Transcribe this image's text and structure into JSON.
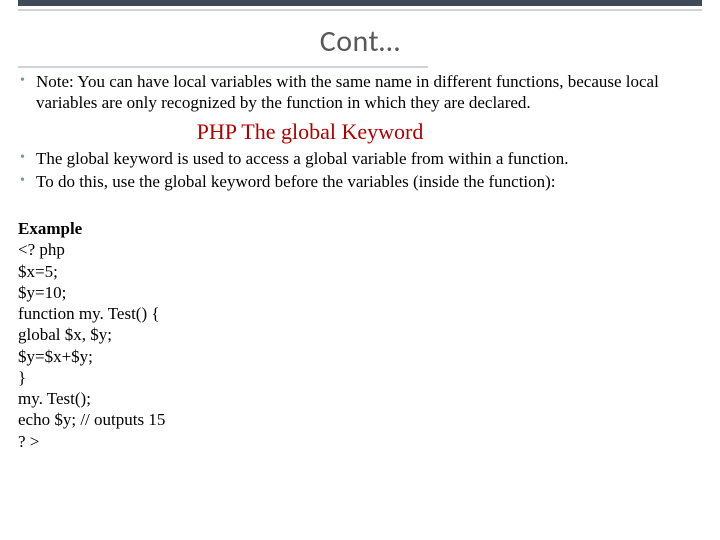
{
  "title": "Cont…",
  "bullets1": [
    "Note: You can have local variables with the same name in different functions, because local variables are only recognized by the function in which they are declared."
  ],
  "subheading": "PHP The global Keyword",
  "bullets2": [
    "The global keyword is used to access a global variable from within a function.",
    "To do this, use the global keyword before the variables (inside the function):"
  ],
  "example_label": "Example",
  "code_lines": [
    "<? php",
    "$x=5;",
    "$y=10;",
    "function my. Test() {",
    "  global $x, $y;",
    "  $y=$x+$y;",
    "}",
    "my. Test();",
    "echo $y; // outputs 15",
    "? >"
  ]
}
